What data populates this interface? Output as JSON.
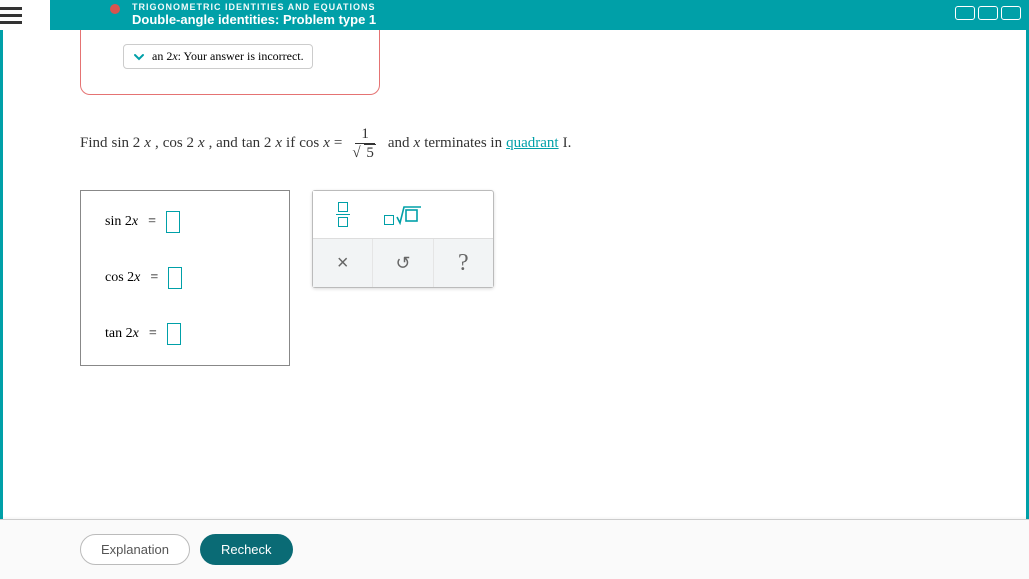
{
  "header": {
    "category": "TRIGONOMETRIC IDENTITIES AND EQUATIONS",
    "title": "Double-angle identities: Problem type 1"
  },
  "feedback": {
    "prefix": "an 2",
    "var": "x",
    "msg": ": Your answer is incorrect."
  },
  "problem": {
    "p1": "Find ",
    "t1": "sin 2",
    "v": "x",
    "sep": ", ",
    "t2": "cos 2",
    "and1": ", and ",
    "t3": "tan 2",
    "if": " if ",
    "cos": "cos",
    "eq": " = ",
    "num": "1",
    "den_rad": "5",
    "p2": " and ",
    "p3": " terminates in ",
    "link": "quadrant",
    "p4": " I."
  },
  "answers": {
    "r1": "sin 2",
    "r2": "cos 2",
    "r3": "tan 2",
    "var": "x",
    "eq": "="
  },
  "tools": {
    "clear": "×",
    "undo": "↺",
    "help": "?"
  },
  "footer": {
    "explanation": "Explanation",
    "recheck": "Recheck"
  }
}
